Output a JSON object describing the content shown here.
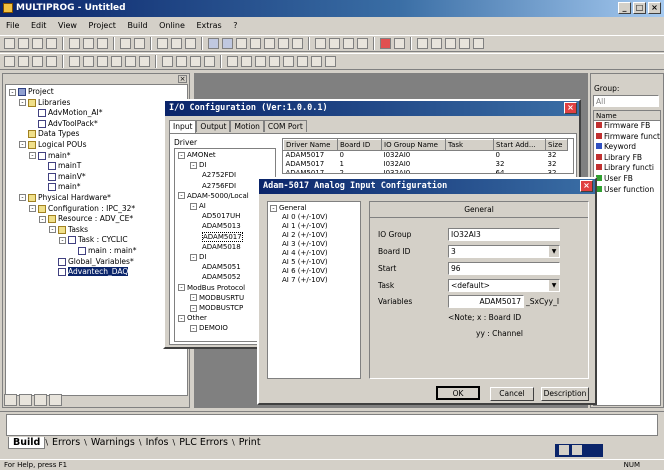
{
  "app": {
    "title": "MULTIPROG - Untitled",
    "min": "_",
    "max": "□",
    "close": "×"
  },
  "menu": [
    "File",
    "Edit",
    "View",
    "Project",
    "Build",
    "Online",
    "Extras",
    "?"
  ],
  "project_tree": [
    {
      "depth": 0,
      "label": "Project",
      "box": "-",
      "icon": "prj"
    },
    {
      "depth": 1,
      "label": "Libraries",
      "box": "-",
      "icon": "folder"
    },
    {
      "depth": 2,
      "label": "AdvMotion_AI*",
      "box": "",
      "icon": "doc"
    },
    {
      "depth": 2,
      "label": "AdvToolPack*",
      "box": "",
      "icon": "doc"
    },
    {
      "depth": 1,
      "label": "Data Types",
      "box": "",
      "icon": "folder"
    },
    {
      "depth": 1,
      "label": "Logical POUs",
      "box": "-",
      "icon": "folder"
    },
    {
      "depth": 2,
      "label": "main*",
      "box": "-",
      "icon": "doc"
    },
    {
      "depth": 3,
      "label": "mainT",
      "box": "",
      "icon": "doc"
    },
    {
      "depth": 3,
      "label": "mainV*",
      "box": "",
      "icon": "doc"
    },
    {
      "depth": 3,
      "label": "main*",
      "box": "",
      "icon": "doc"
    },
    {
      "depth": 1,
      "label": "Physical Hardware*",
      "box": "-",
      "icon": "folder"
    },
    {
      "depth": 2,
      "label": "Configuration : IPC_32*",
      "box": "-",
      "icon": "folder"
    },
    {
      "depth": 3,
      "label": "Resource : ADV_CE*",
      "box": "-",
      "icon": "folder"
    },
    {
      "depth": 4,
      "label": "Tasks",
      "box": "-",
      "icon": "folder"
    },
    {
      "depth": 5,
      "label": "Task : CYCLIC",
      "box": "-",
      "icon": "doc"
    },
    {
      "depth": 6,
      "label": "main : main*",
      "box": "",
      "icon": "doc"
    },
    {
      "depth": 4,
      "label": "Global_Variables*",
      "box": "",
      "icon": "doc"
    },
    {
      "depth": 4,
      "label": "Advantech_DAQ",
      "box": "",
      "icon": "doc",
      "selected": true
    }
  ],
  "right_panel": {
    "group_label": "Group:",
    "group_value": "All",
    "column": "Name",
    "items": [
      "Firmware FB",
      "Firmware funct",
      "Keyword",
      "Library FB",
      "Library functi",
      "User FB",
      "User function"
    ]
  },
  "io_dialog": {
    "title": "I/O Configuration (Ver:1.0.0.1)",
    "tabs": [
      "Input",
      "Output",
      "Motion",
      "COM Port"
    ],
    "driver_label": "Driver",
    "driver_tree": [
      {
        "depth": 0,
        "label": "AMONet"
      },
      {
        "depth": 1,
        "label": "DI"
      },
      {
        "depth": 2,
        "label": "A2752FDI"
      },
      {
        "depth": 2,
        "label": "A2756FDI"
      },
      {
        "depth": 0,
        "label": "ADAM-5000/Local"
      },
      {
        "depth": 1,
        "label": "AI"
      },
      {
        "depth": 2,
        "label": "AD5017UH"
      },
      {
        "depth": 2,
        "label": "ADAM5013"
      },
      {
        "depth": 2,
        "label": "ADAM5017"
      },
      {
        "depth": 2,
        "label": "ADAM5018"
      },
      {
        "depth": 1,
        "label": "DI"
      },
      {
        "depth": 2,
        "label": "ADAM5051"
      },
      {
        "depth": 2,
        "label": "ADAM5052"
      },
      {
        "depth": 0,
        "label": "ModBus Protocol"
      },
      {
        "depth": 1,
        "label": "MODBUSRTU"
      },
      {
        "depth": 1,
        "label": "MODBUSTCP"
      },
      {
        "depth": 0,
        "label": "Other"
      },
      {
        "depth": 1,
        "label": "DEMOIO"
      }
    ],
    "table_headers": [
      "Driver Name",
      "Board ID",
      "IO Group Name",
      "Task",
      "Start Add...",
      "Size"
    ],
    "rows": [
      [
        "ADAM5017",
        "0",
        "I032AI0",
        "",
        "0",
        "32"
      ],
      [
        "ADAM5017",
        "1",
        "I032AI0",
        "",
        "32",
        "32"
      ],
      [
        "ADAM5017",
        "2",
        "I032AI0",
        "",
        "64",
        "32"
      ]
    ]
  },
  "adam_dialog": {
    "title": "Adam-5017 Analog Input Configuration",
    "tree_root": "General",
    "channels": [
      "AI 0 (+/-10V)",
      "AI 1 (+/-10V)",
      "AI 2 (+/-10V)",
      "AI 3 (+/-10V)",
      "AI 4 (+/-10V)",
      "AI 5 (+/-10V)",
      "AI 6 (+/-10V)",
      "AI 7 (+/-10V)"
    ],
    "section": "General",
    "io_group_label": "IO Group",
    "io_group_value": "IO32AI3",
    "board_id_label": "Board ID",
    "board_id_value": "3",
    "start_label": "Start",
    "start_value": "96",
    "task_label": "Task",
    "task_value": "<default>",
    "variables_label": "Variables",
    "variables_value": "ADAM5017",
    "variables_suffix": "_SxCyy_I",
    "note1": "<Note; x : Board ID",
    "note2": "yy : Channel",
    "ok": "OK",
    "cancel": "Cancel",
    "description": "Description"
  },
  "bottom_tabs": [
    "Build",
    "Errors",
    "Warnings",
    "Infos",
    "PLC Errors",
    "Print"
  ],
  "status_bar": {
    "left": "For Help, press F1",
    "right": "NUM"
  }
}
